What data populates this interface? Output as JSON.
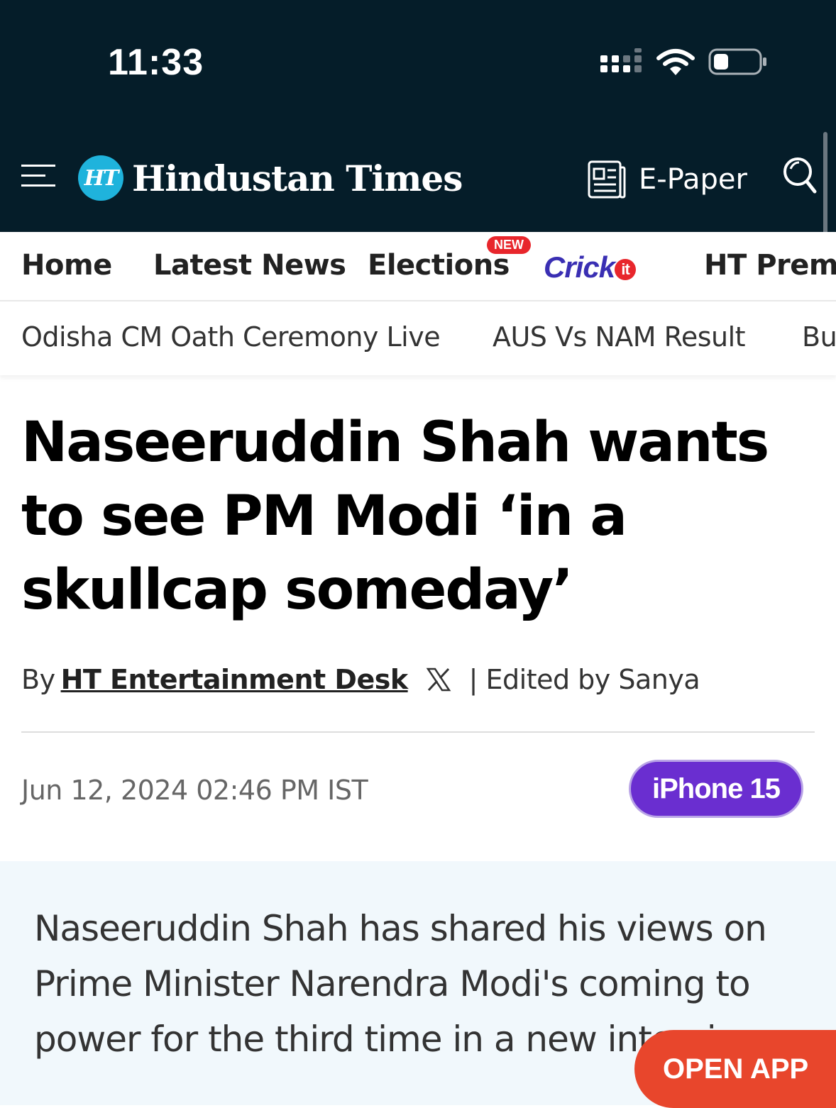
{
  "status_bar": {
    "time": "11:33"
  },
  "header": {
    "logo_badge": "HT",
    "logo_text": "Hindustan Times",
    "epaper_label": "E-Paper"
  },
  "nav": {
    "items": [
      "Home",
      "Latest News",
      "Elections",
      "HT Premium"
    ],
    "new_badge": "NEW",
    "crickit": "Crick"
  },
  "subnav": {
    "items": [
      "Odisha CM Oath Ceremony Live",
      "AUS Vs NAM Result",
      "Bu"
    ]
  },
  "article": {
    "headline": "Naseeruddin Shah wants to see PM Modi ‘in a skullcap someday’",
    "by_prefix": "By",
    "author": "HT Entertainment Desk",
    "edited_by": "| Edited by Sanya",
    "date": "Jun 12, 2024 02:46 PM IST",
    "summary": "Naseeruddin Shah has shared his views on Prime Minister Narendra Modi's coming to power for the third time in a new interview"
  },
  "ad_badge": "iPhone 15",
  "open_app": "OPEN APP",
  "colors": {
    "header_bg": "#051d29",
    "logo_blue": "#1fb3dc",
    "new_red": "#e8262c",
    "iphone_purple": "#6a2ed0",
    "open_app": "#e8462c"
  }
}
